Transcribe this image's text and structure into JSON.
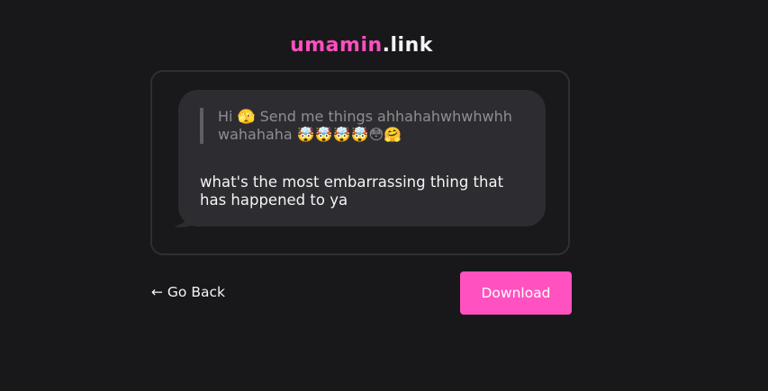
{
  "header": {
    "logo_brand": "umamin",
    "logo_tld": ".link"
  },
  "message_card": {
    "prompt_text": "Hi 🫣 Send me things ahhahahwhwhwhhwahahaha 🤯🤯🤯🤯😳🤗",
    "question_text": "what's the most embarrassing thing that has happened to ya"
  },
  "actions": {
    "back_label": "← Go Back",
    "download_label": "Download"
  },
  "colors": {
    "background": "#18181b",
    "accent": "#ff52c0",
    "bubble": "#2d2d31"
  }
}
